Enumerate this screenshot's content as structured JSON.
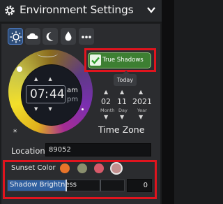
{
  "header": {
    "title": "Environment Settings"
  },
  "tabs": [
    {
      "icon": "sun-gear-icon",
      "active": true
    },
    {
      "icon": "cloud-icon"
    },
    {
      "icon": "moon-icon"
    },
    {
      "icon": "droplet-icon"
    },
    {
      "icon": "more-icon"
    }
  ],
  "time": {
    "hours": "07",
    "minutes": "44",
    "am": "am",
    "pm": "pm"
  },
  "true_shadows": {
    "label": "True Shadows",
    "checked": true
  },
  "date": {
    "today_label": "Today",
    "month": "02",
    "day": "11",
    "year": "2021",
    "month_cap": "Month",
    "day_cap": "Day",
    "year_cap": "Year",
    "time_zone_label": "Time Zone"
  },
  "location": {
    "label": "Location",
    "value": "89052"
  },
  "sunset": {
    "label": "Sunset Color",
    "swatches": [
      "#e8742a",
      "#8a8f6e",
      "#d75a6a",
      "#c38e8e"
    ]
  },
  "shadow_brightness": {
    "label": "Shadow Brightness",
    "level_percent": 50,
    "value": "0"
  },
  "colors": {
    "accent": "#2f5fa0",
    "toggle_green": "#3d7f32",
    "highlight_red": "#e0141e"
  }
}
